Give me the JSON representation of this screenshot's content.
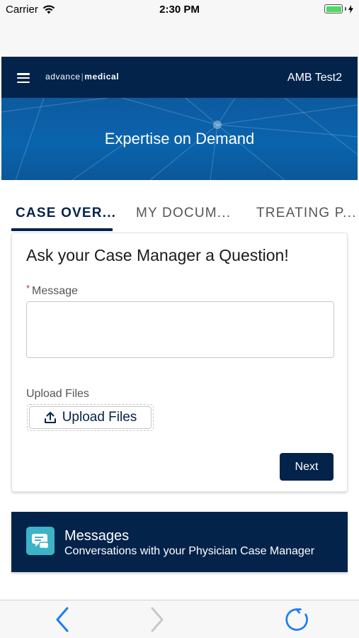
{
  "status_bar": {
    "carrier": "Carrier",
    "time": "2:30 PM",
    "battery_icon": "battery-charging-icon",
    "wifi_icon": "wifi-icon"
  },
  "header": {
    "brand_left": "advance",
    "brand_sep": "|",
    "brand_right": "medical",
    "user": "AMB Test2",
    "bg_color": "#03234b"
  },
  "hero": {
    "title": "Expertise on Demand"
  },
  "tabs": [
    {
      "label": "CASE OVER...",
      "active": true
    },
    {
      "label": "MY DOCUM...",
      "active": false
    },
    {
      "label": "TREATING P...",
      "active": false
    }
  ],
  "form": {
    "title": "Ask your Case Manager a Question!",
    "required_marker": "*",
    "message_label": "Message",
    "message_value": "",
    "upload_label": "Upload Files",
    "upload_button": "Upload Files",
    "next_button": "Next"
  },
  "messages_card": {
    "title": "Messages",
    "subtitle": "Conversations with your Physician Case Manager",
    "icon": "chat-bubble-icon"
  },
  "toolbar": {
    "back_icon": "chevron-left-icon",
    "forward_icon": "chevron-right-icon",
    "refresh_icon": "refresh-icon"
  },
  "colors": {
    "navy": "#03234b",
    "hero_blue": "#0a64ad",
    "teal": "#3cb3c7",
    "ios_blue": "#1a7cf6"
  }
}
